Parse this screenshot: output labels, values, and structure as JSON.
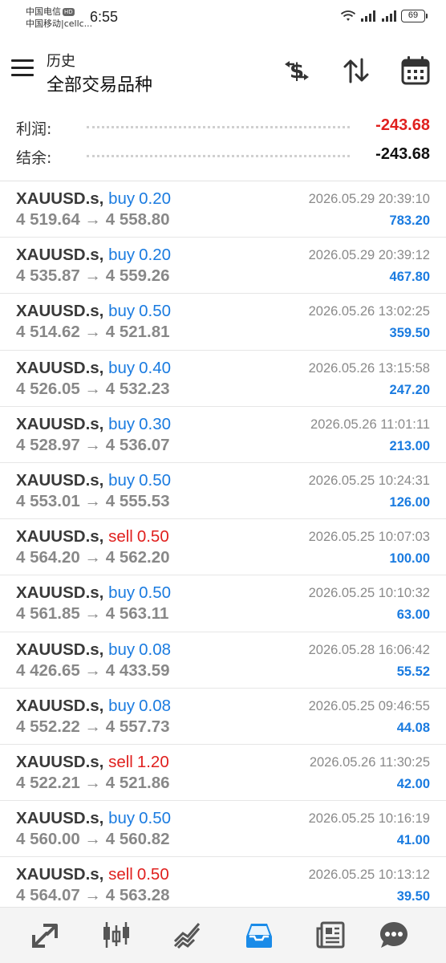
{
  "status_bar": {
    "carrier1": "中国电信",
    "carrier1_badge": "HD",
    "carrier2": "中国移动|cellc...",
    "time": "6:55",
    "battery": "69"
  },
  "header": {
    "subtitle": "历史",
    "title": "全部交易品种",
    "icons": [
      "menu-icon",
      "currency-exchange-icon",
      "sort-icon",
      "calendar-icon"
    ]
  },
  "summary": {
    "profit_label": "利润:",
    "profit_value": "-243.68",
    "balance_label": "结余:",
    "balance_value": "-243.68",
    "profit_color": "#e0201e"
  },
  "colors": {
    "buy": "#1a7be0",
    "sell": "#e0201e",
    "profit": "#1a7be0",
    "nav_active": "#1a8be8"
  },
  "trades": [
    {
      "symbol": "XAUUSD.s,",
      "type": "buy",
      "lot": "0.20",
      "open": "4 519.64",
      "arrow": "→",
      "close": "4 558.80",
      "time": "2026.05.29 20:39:10",
      "profit": "783.20"
    },
    {
      "symbol": "XAUUSD.s,",
      "type": "buy",
      "lot": "0.20",
      "open": "4 535.87",
      "arrow": "→",
      "close": "4 559.26",
      "time": "2026.05.29 20:39:12",
      "profit": "467.80"
    },
    {
      "symbol": "XAUUSD.s,",
      "type": "buy",
      "lot": "0.50",
      "open": "4 514.62",
      "arrow": "→",
      "close": "4 521.81",
      "time": "2026.05.26 13:02:25",
      "profit": "359.50"
    },
    {
      "symbol": "XAUUSD.s,",
      "type": "buy",
      "lot": "0.40",
      "open": "4 526.05",
      "arrow": "→",
      "close": "4 532.23",
      "time": "2026.05.26 13:15:58",
      "profit": "247.20"
    },
    {
      "symbol": "XAUUSD.s,",
      "type": "buy",
      "lot": "0.30",
      "open": "4 528.97",
      "arrow": "→",
      "close": "4 536.07",
      "time": "2026.05.26 11:01:11",
      "profit": "213.00"
    },
    {
      "symbol": "XAUUSD.s,",
      "type": "buy",
      "lot": "0.50",
      "open": "4 553.01",
      "arrow": "→",
      "close": "4 555.53",
      "time": "2026.05.25 10:24:31",
      "profit": "126.00"
    },
    {
      "symbol": "XAUUSD.s,",
      "type": "sell",
      "lot": "0.50",
      "open": "4 564.20",
      "arrow": "→",
      "close": "4 562.20",
      "time": "2026.05.25 10:07:03",
      "profit": "100.00"
    },
    {
      "symbol": "XAUUSD.s,",
      "type": "buy",
      "lot": "0.50",
      "open": "4 561.85",
      "arrow": "→",
      "close": "4 563.11",
      "time": "2026.05.25 10:10:32",
      "profit": "63.00"
    },
    {
      "symbol": "XAUUSD.s,",
      "type": "buy",
      "lot": "0.08",
      "open": "4 426.65",
      "arrow": "→",
      "close": "4 433.59",
      "time": "2026.05.28 16:06:42",
      "profit": "55.52"
    },
    {
      "symbol": "XAUUSD.s,",
      "type": "buy",
      "lot": "0.08",
      "open": "4 552.22",
      "arrow": "→",
      "close": "4 557.73",
      "time": "2026.05.25 09:46:55",
      "profit": "44.08"
    },
    {
      "symbol": "XAUUSD.s,",
      "type": "sell",
      "lot": "1.20",
      "open": "4 522.21",
      "arrow": "→",
      "close": "4 521.86",
      "time": "2026.05.26 11:30:25",
      "profit": "42.00"
    },
    {
      "symbol": "XAUUSD.s,",
      "type": "buy",
      "lot": "0.50",
      "open": "4 560.00",
      "arrow": "→",
      "close": "4 560.82",
      "time": "2026.05.25 10:16:19",
      "profit": "41.00"
    },
    {
      "symbol": "XAUUSD.s,",
      "type": "sell",
      "lot": "0.50",
      "open": "4 564.07",
      "arrow": "→",
      "close": "4 563.28",
      "time": "2026.05.25 10:13:12",
      "profit": "39.50"
    }
  ],
  "bottom_nav": {
    "items": [
      "quotes-icon",
      "chart-icon",
      "trade-icon",
      "history-icon",
      "news-icon",
      "chat-icon"
    ],
    "active": "history-icon"
  }
}
